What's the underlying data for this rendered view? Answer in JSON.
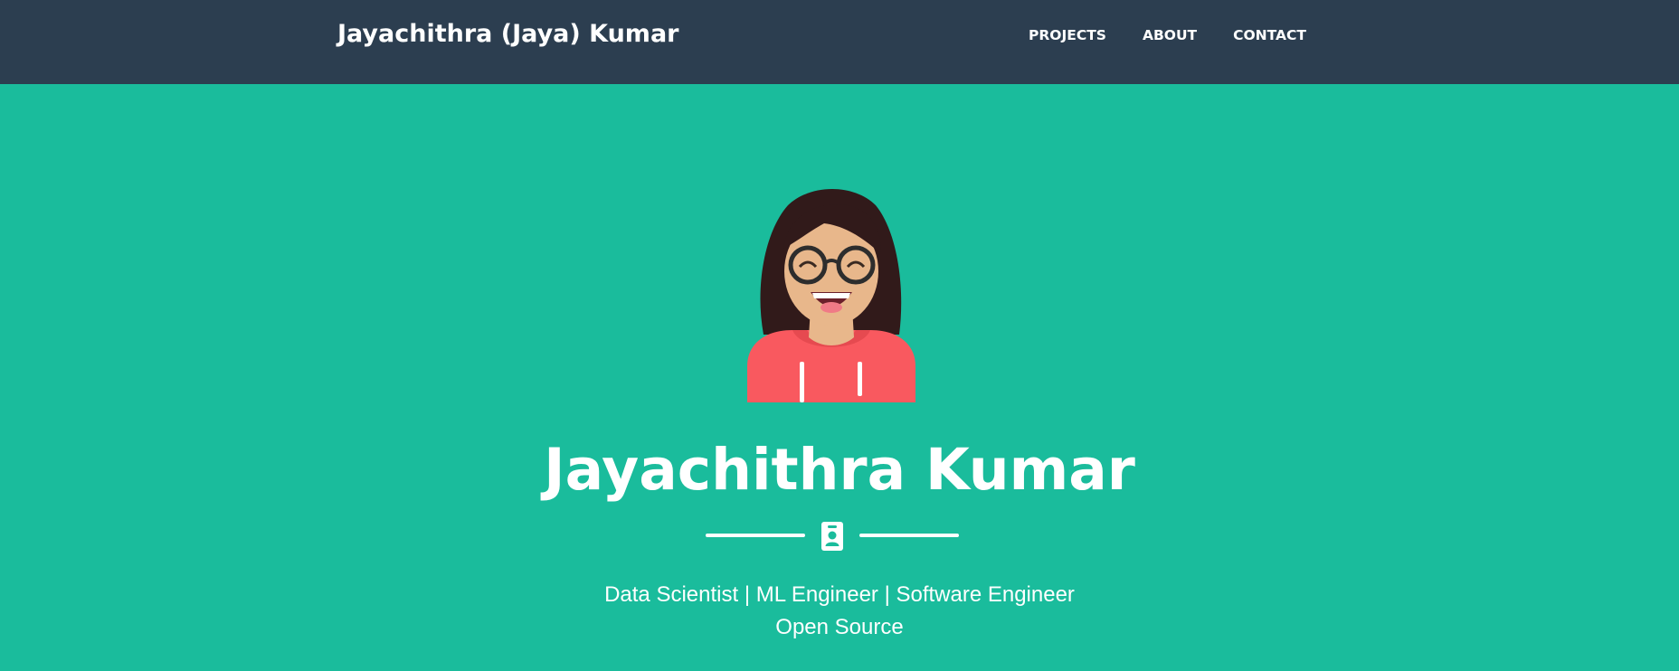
{
  "nav": {
    "brand": "Jayachithra (Jaya) Kumar",
    "links": [
      {
        "label": "PROJECTS"
      },
      {
        "label": "ABOUT"
      },
      {
        "label": "CONTACT"
      }
    ]
  },
  "masthead": {
    "heading": "Jayachithra Kumar",
    "subheading_line1": "Data Scientist | ML Engineer | Software Engineer",
    "subheading_line2": "Open Source",
    "avatar_icon": "smiling-girl-avatar",
    "divider_icon": "id-badge-icon"
  },
  "colors": {
    "navbar": "#2c3e50",
    "primary": "#1abc9c",
    "text": "#ffffff",
    "hoodie": "#f9595f"
  }
}
